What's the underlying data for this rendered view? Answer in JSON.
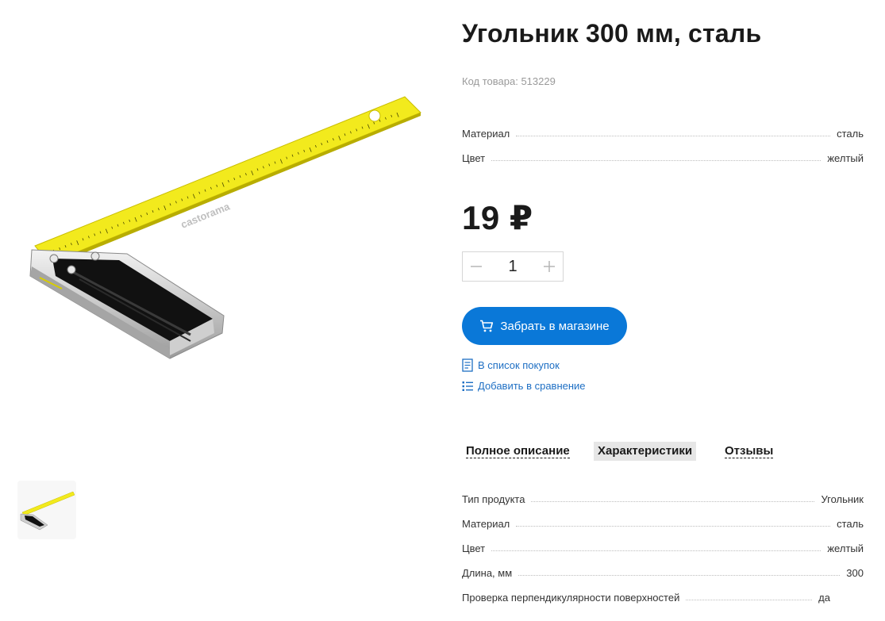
{
  "gallery": {
    "watermark": "castorama"
  },
  "product": {
    "title": "Угольник 300 мм, сталь",
    "sku_label": "Код товара:",
    "sku_value": "513229",
    "price": "19 ₽",
    "quantity": "1"
  },
  "brief_specs": [
    {
      "label": "Материал",
      "value": "сталь"
    },
    {
      "label": "Цвет",
      "value": "желтый"
    }
  ],
  "actions": {
    "pickup_label": "Забрать в магазине",
    "shopping_list_label": "В список покупок",
    "compare_label": "Добавить в сравнение"
  },
  "tabs": [
    {
      "label": "Полное описание",
      "active": false
    },
    {
      "label": "Характеристики",
      "active": true
    },
    {
      "label": "Отзывы",
      "active": false
    }
  ],
  "characteristics": [
    {
      "label": "Тип продукта",
      "value": "Угольник"
    },
    {
      "label": "Материал",
      "value": "сталь"
    },
    {
      "label": "Цвет",
      "value": "желтый"
    },
    {
      "label": "Длина, мм",
      "value": "300"
    },
    {
      "label": "Проверка перпендикулярности поверхностей",
      "value": "да"
    }
  ],
  "colors": {
    "accent": "#0a78d8",
    "link": "#1e6fc4",
    "ruler": "#f2ea1d"
  },
  "icons": [
    "minus-icon",
    "plus-icon",
    "cart-icon",
    "list-icon",
    "compare-icon"
  ]
}
